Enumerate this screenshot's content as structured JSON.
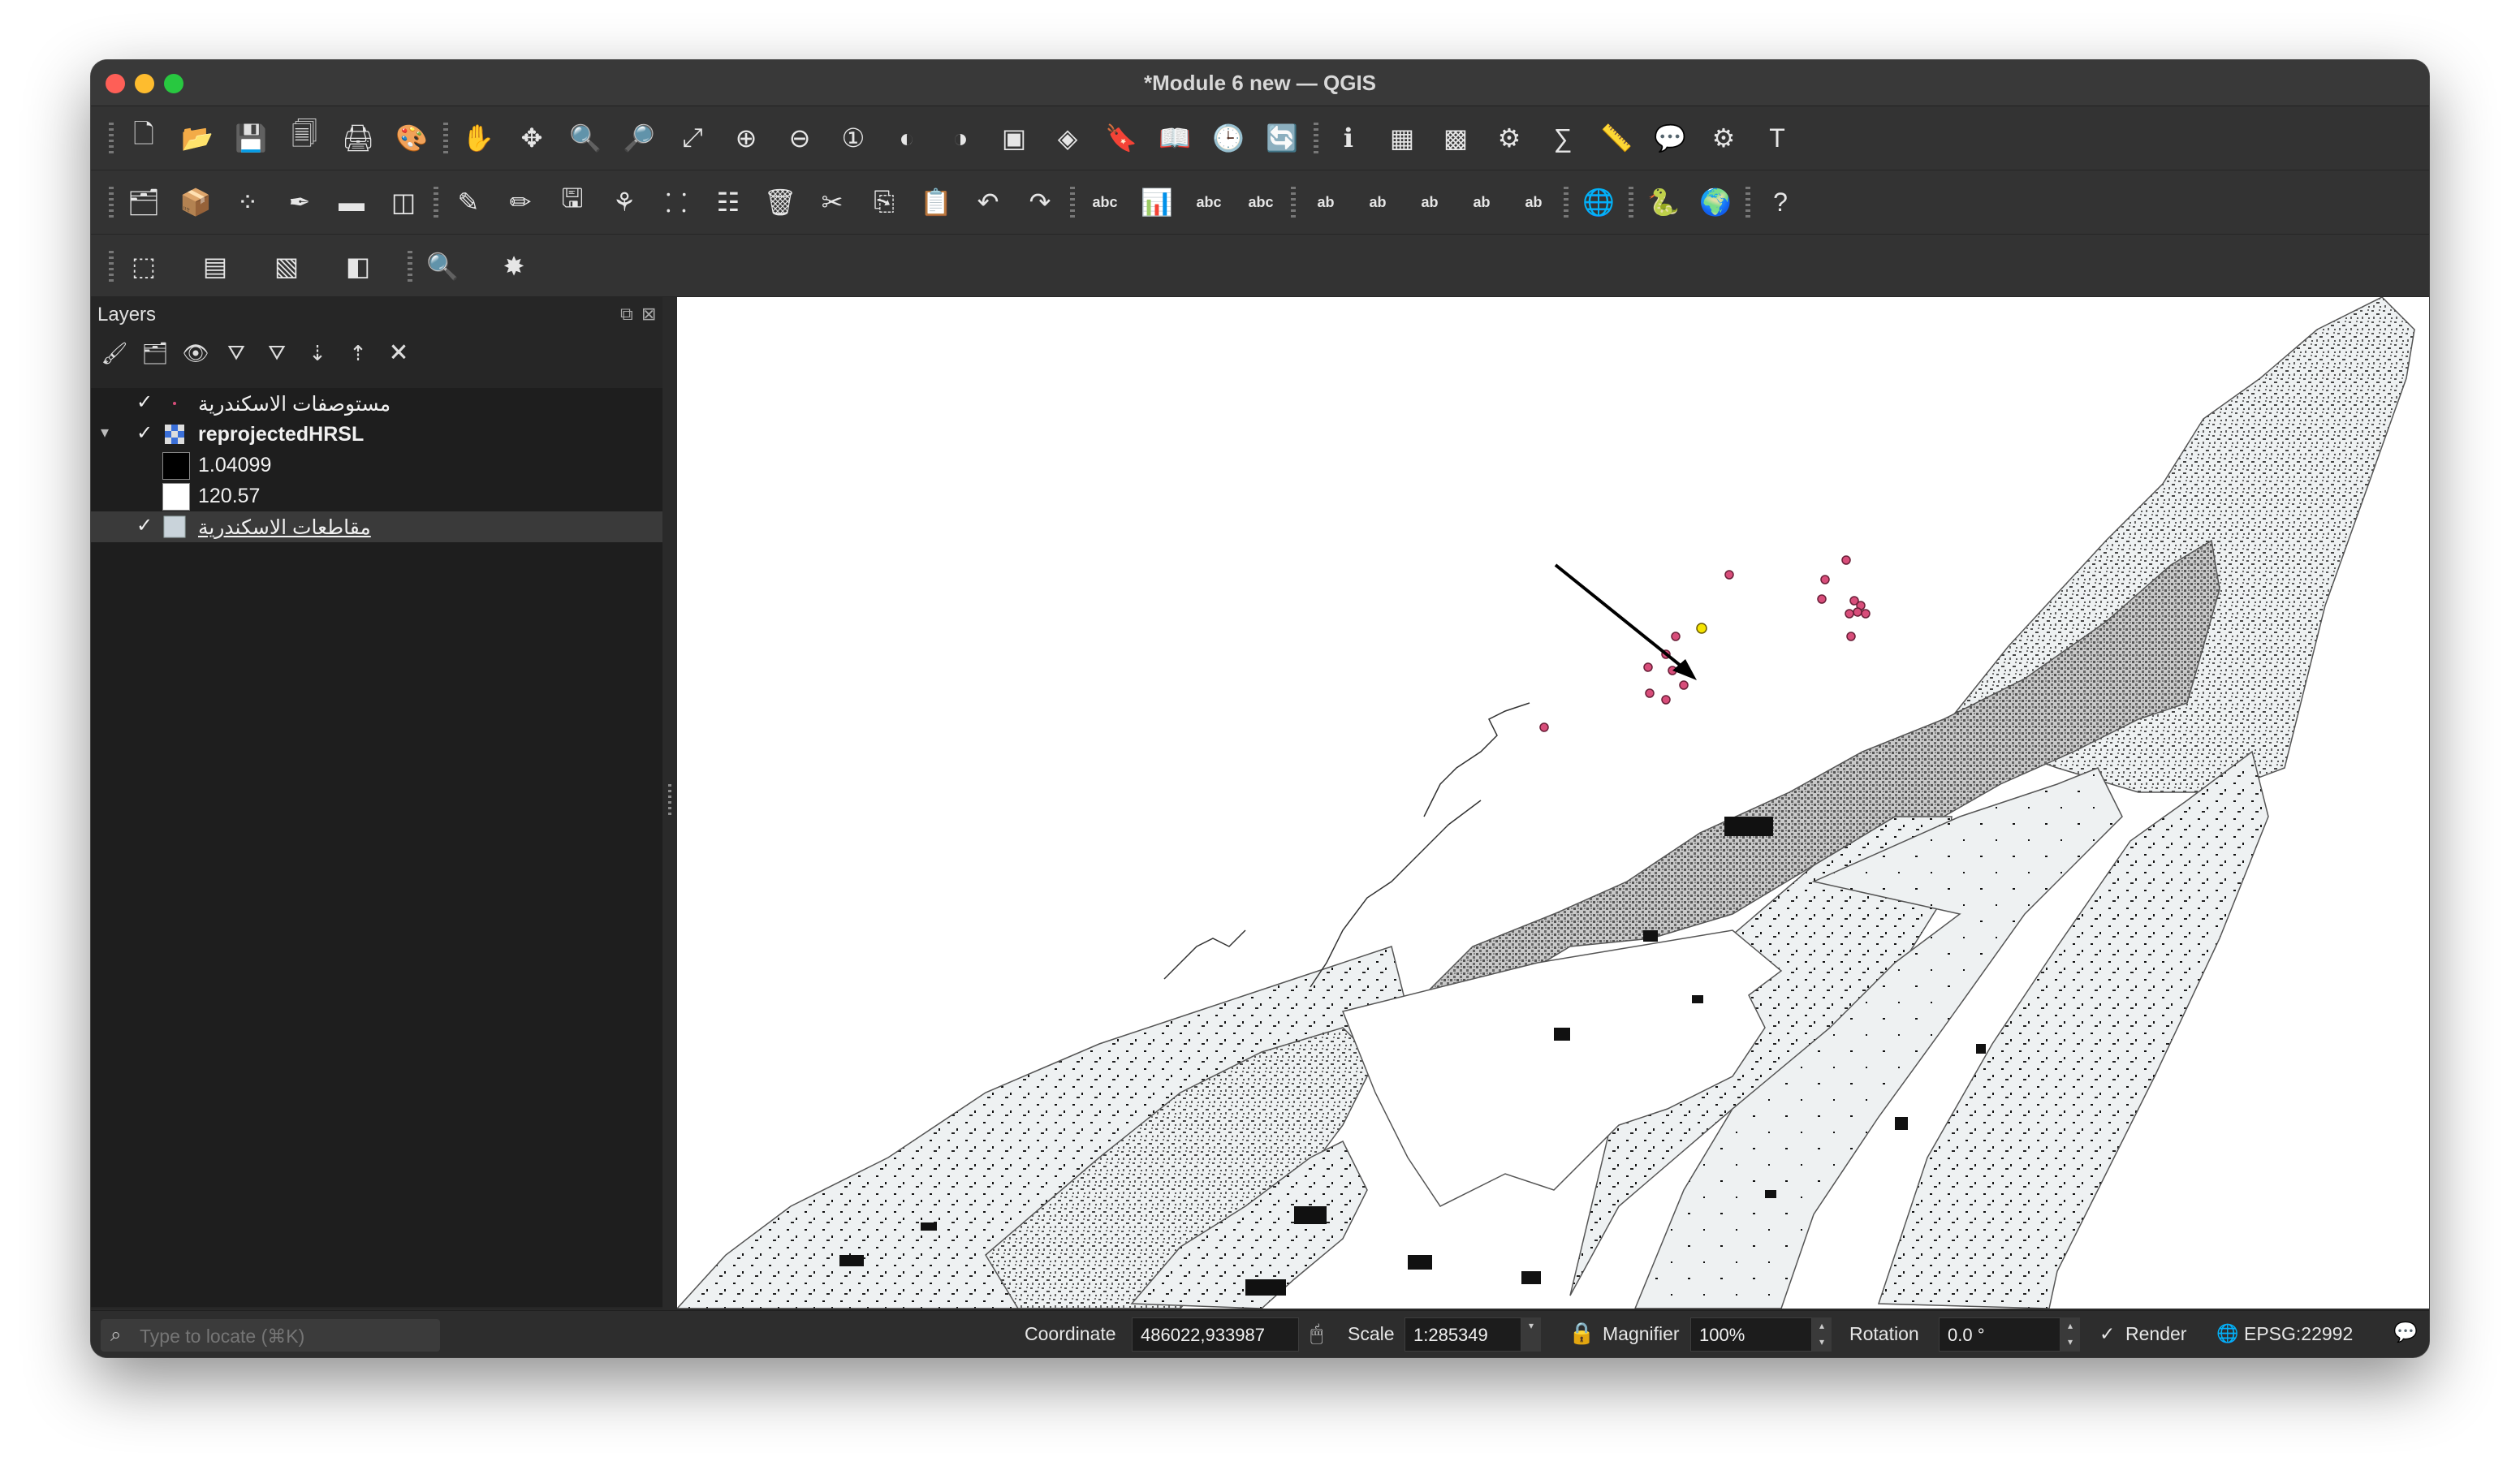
{
  "window": {
    "title": "*Module 6 new — QGIS"
  },
  "toolbars": {
    "row1": [
      {
        "name": "new-project-icon",
        "glyph": "🗋"
      },
      {
        "name": "open-project-icon",
        "glyph": "📂"
      },
      {
        "name": "save-project-icon",
        "glyph": "💾"
      },
      {
        "name": "save-as-icon",
        "glyph": "🗐"
      },
      {
        "name": "print-layout-icon",
        "glyph": "🖨"
      },
      {
        "name": "style-manager-icon",
        "glyph": "🎨"
      },
      {
        "name": "pan-icon",
        "glyph": "✋"
      },
      {
        "name": "pan-to-selection-icon",
        "glyph": "✥"
      },
      {
        "name": "zoom-in-icon",
        "glyph": "🔍"
      },
      {
        "name": "zoom-out-icon",
        "glyph": "🔎"
      },
      {
        "name": "zoom-full-icon",
        "glyph": "⤢"
      },
      {
        "name": "zoom-to-selection-icon",
        "glyph": "⊕"
      },
      {
        "name": "zoom-to-layer-icon",
        "glyph": "⊖"
      },
      {
        "name": "zoom-native-icon",
        "glyph": "①"
      },
      {
        "name": "zoom-last-icon",
        "glyph": "◐"
      },
      {
        "name": "zoom-next-icon",
        "glyph": "◑"
      },
      {
        "name": "new-map-view-icon",
        "glyph": "▣"
      },
      {
        "name": "new-3d-view-icon",
        "glyph": "◈"
      },
      {
        "name": "new-bookmark-icon",
        "glyph": "🔖"
      },
      {
        "name": "show-bookmarks-icon",
        "glyph": "📖"
      },
      {
        "name": "temporal-controller-icon",
        "glyph": "🕒"
      },
      {
        "name": "refresh-icon",
        "glyph": "🔄"
      },
      {
        "name": "identify-icon",
        "glyph": "ℹ"
      },
      {
        "name": "attribute-table-icon",
        "glyph": "▦"
      },
      {
        "name": "statistical-summary-icon",
        "glyph": "▩"
      },
      {
        "name": "processing-toolbox-icon",
        "glyph": "⚙"
      },
      {
        "name": "field-calculator-icon",
        "glyph": "∑"
      },
      {
        "name": "measure-icon",
        "glyph": "📏"
      },
      {
        "name": "map-tips-icon",
        "glyph": "💬"
      },
      {
        "name": "annotations-icon",
        "glyph": "⚙"
      },
      {
        "name": "text-annotation-icon",
        "glyph": "T"
      }
    ],
    "row2": [
      {
        "name": "data-source-manager-icon",
        "glyph": "🗂"
      },
      {
        "name": "new-geopackage-layer-icon",
        "glyph": "📦"
      },
      {
        "name": "new-temporary-layer-icon",
        "glyph": "⁘"
      },
      {
        "name": "digitize-icon",
        "glyph": "✒"
      },
      {
        "name": "new-virtual-layer-icon",
        "glyph": "▬"
      },
      {
        "name": "geometry-validation-icon",
        "glyph": "◫"
      },
      {
        "name": "current-edits-icon",
        "glyph": "✎"
      },
      {
        "name": "toggle-editing-icon",
        "glyph": "✏"
      },
      {
        "name": "save-edits-icon",
        "glyph": "🖫"
      },
      {
        "name": "add-feature-icon",
        "glyph": "⚘"
      },
      {
        "name": "vertex-tool-icon",
        "glyph": "⸬"
      },
      {
        "name": "modify-attributes-icon",
        "glyph": "☷"
      },
      {
        "name": "delete-selected-icon",
        "glyph": "🗑"
      },
      {
        "name": "cut-features-icon",
        "glyph": "✂"
      },
      {
        "name": "copy-features-icon",
        "glyph": "⎘"
      },
      {
        "name": "paste-features-icon",
        "glyph": "📋"
      },
      {
        "name": "undo-icon",
        "glyph": "↶"
      },
      {
        "name": "redo-icon",
        "glyph": "↷"
      },
      {
        "name": "label-layer-icon",
        "glyph": "abc"
      },
      {
        "name": "diagram-icon",
        "glyph": "📊"
      },
      {
        "name": "pin-labels-icon",
        "glyph": "abc"
      },
      {
        "name": "show-labels-icon",
        "glyph": "abc"
      },
      {
        "name": "label-tool-1-icon",
        "glyph": "ab"
      },
      {
        "name": "label-tool-2-icon",
        "glyph": "ab"
      },
      {
        "name": "label-tool-3-icon",
        "glyph": "ab"
      },
      {
        "name": "label-tool-4-icon",
        "glyph": "ab"
      },
      {
        "name": "label-tool-5-icon",
        "glyph": "ab"
      },
      {
        "name": "plugins-icon",
        "glyph": "🌐"
      },
      {
        "name": "python-console-icon",
        "glyph": "🐍"
      },
      {
        "name": "globe-icon",
        "glyph": "🌍"
      },
      {
        "name": "help-icon",
        "glyph": "?"
      }
    ],
    "row3": [
      {
        "name": "select-features-icon",
        "glyph": "⬚"
      },
      {
        "name": "select-by-value-icon",
        "glyph": "▤"
      },
      {
        "name": "deselect-all-icon",
        "glyph": "▧"
      },
      {
        "name": "select-location-icon",
        "glyph": "◧"
      },
      {
        "name": "locator-search-icon",
        "glyph": "🔍"
      },
      {
        "name": "georeferencer-icon",
        "glyph": "✸"
      }
    ]
  },
  "layers_panel": {
    "title": "Layers",
    "tools": [
      "open-styling-icon",
      "add-group-icon",
      "manage-visibility-icon",
      "filter-legend-icon",
      "filter-by-expression-icon",
      "expand-all-icon",
      "collapse-all-icon",
      "remove-layer-icon"
    ],
    "items": [
      {
        "label": "مستوصفات الاسكندرية",
        "checked": "✓",
        "type": "point",
        "bold": false
      },
      {
        "label": "reprojectedHRSL",
        "checked": "✓",
        "type": "raster",
        "bold": true
      },
      {
        "label": "مقاطعات الاسكندرية",
        "checked": "✓",
        "type": "polygon",
        "bold": false,
        "selected": true
      }
    ],
    "raster_legend": [
      {
        "label": "1.04099",
        "color": "#000000"
      },
      {
        "label": "120.57",
        "color": "#ffffff"
      }
    ]
  },
  "statusbar": {
    "locate_placeholder": "Type to locate (⌘K)",
    "coordinate_label": "Coordinate",
    "coordinate_value": "486022,933987",
    "scale_label": "Scale",
    "scale_value": "1:285349",
    "magnifier_label": "Magnifier",
    "magnifier_value": "100%",
    "rotation_label": "Rotation",
    "rotation_value": "0.0 °",
    "render_check": "✓",
    "render_label": "Render",
    "crs": "EPSG:22992"
  },
  "colors": {
    "polygon_fill": "#eef1f2",
    "point_fill": "#d84d7a",
    "highlight_point": "#f5e400",
    "raster_dark": "#111111"
  }
}
